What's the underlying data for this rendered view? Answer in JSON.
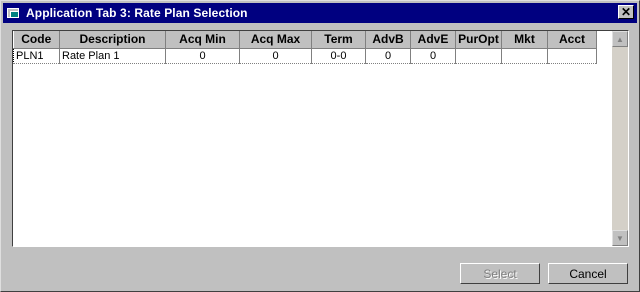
{
  "window": {
    "title": "Application Tab 3: Rate Plan Selection",
    "close_glyph": "✕"
  },
  "grid": {
    "columns": [
      "Code",
      "Description",
      "Acq Min",
      "Acq Max",
      "Term",
      "AdvB",
      "AdvE",
      "PurOpt",
      "Mkt",
      "Acct"
    ],
    "rows": [
      [
        "PLN1",
        "Rate Plan 1",
        "0",
        "0",
        "0-0",
        "0",
        "0",
        "",
        "",
        ""
      ]
    ]
  },
  "scrollbar": {
    "up_glyph": "▲",
    "down_glyph": "▼"
  },
  "buttons": {
    "select_label": "Select",
    "cancel_label": "Cancel"
  }
}
